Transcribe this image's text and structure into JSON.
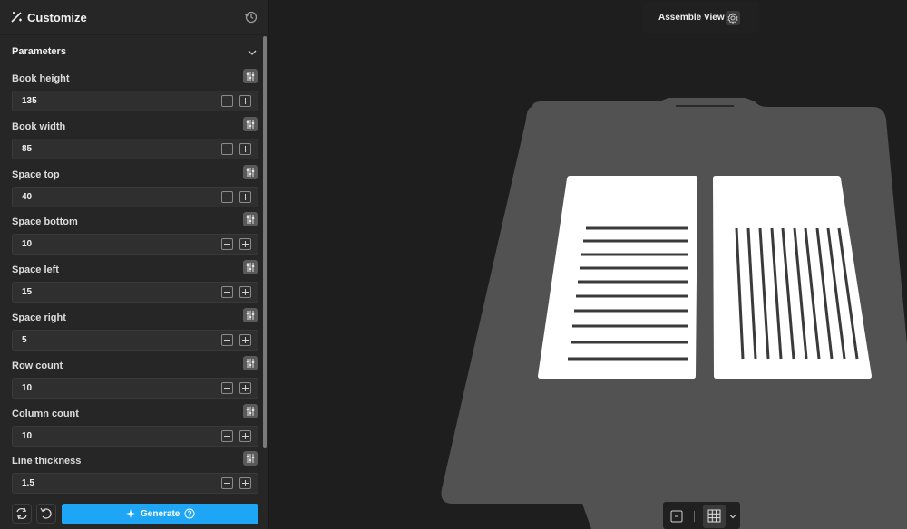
{
  "sidebar": {
    "title": "Customize",
    "section_title": "Parameters",
    "params": [
      {
        "label": "Book height",
        "value": "135"
      },
      {
        "label": "Book width",
        "value": "85"
      },
      {
        "label": "Space top",
        "value": "40"
      },
      {
        "label": "Space bottom",
        "value": "10"
      },
      {
        "label": "Space left",
        "value": "15"
      },
      {
        "label": "Space right",
        "value": "5"
      },
      {
        "label": "Row count",
        "value": "10"
      },
      {
        "label": "Column count",
        "value": "10"
      },
      {
        "label": "Line thickness",
        "value": "1.5"
      }
    ],
    "generate_label": "Generate"
  },
  "viewport": {
    "assemble_label": "Assemble View"
  },
  "colors": {
    "accent": "#1ea5f5",
    "plate": "#525252",
    "page": "#ffffff"
  }
}
